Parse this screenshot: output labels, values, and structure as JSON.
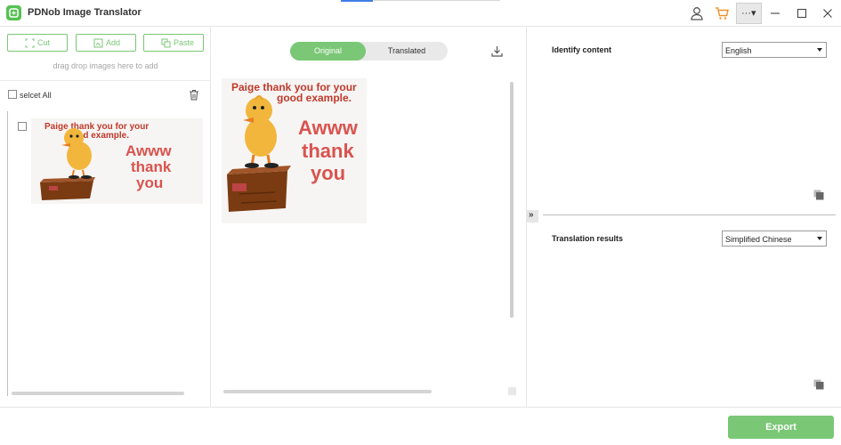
{
  "app": {
    "title": "PDNob Image Translator"
  },
  "toolbar": {
    "cut_label": "Cut",
    "add_label": "Add",
    "paste_label": "Paste"
  },
  "left": {
    "drop_hint": "drag drop images here to add",
    "select_all_label": "selcet All"
  },
  "image": {
    "line1": "Paige thank you for your",
    "line2": "good example.",
    "word1": "Awww",
    "word2": "thank",
    "word3": "you"
  },
  "view_toggle": {
    "original_label": "Original",
    "translated_label": "Translated"
  },
  "identify": {
    "label": "Identify content",
    "selected": "English"
  },
  "results": {
    "label": "Translation results",
    "selected": "Simplified Chinese"
  },
  "expand": {
    "glyph": "»"
  },
  "more": {
    "glyph": "···▾"
  },
  "footer": {
    "export_label": "Export"
  },
  "colors": {
    "accent": "#7ac776",
    "logo": "#56c152",
    "cart": "#f0902a"
  }
}
